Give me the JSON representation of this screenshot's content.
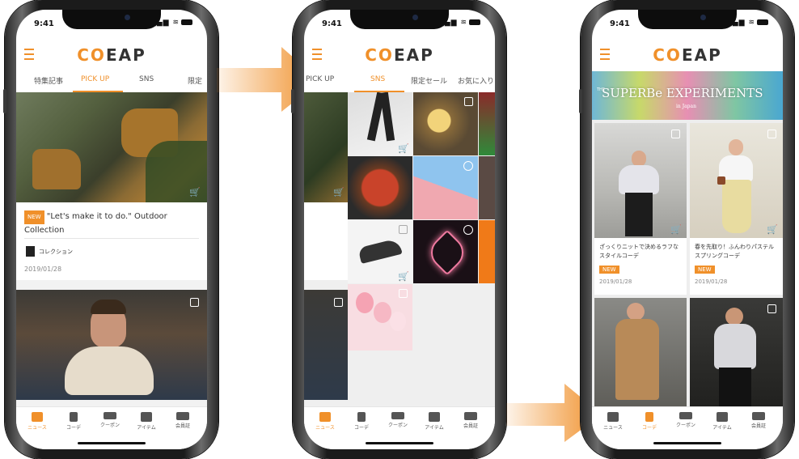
{
  "status_time": "9:41",
  "logo": {
    "mark": "CO",
    "word": "EAP"
  },
  "phone1": {
    "tabs": [
      "特集記事",
      "PICK UP",
      "SNS",
      "限定"
    ],
    "active_tab": 1,
    "card": {
      "new_label": "NEW",
      "title": "\"Let's make it to do.\" Outdoor Collection",
      "category": "コレクション",
      "date": "2019/01/28"
    }
  },
  "phone2": {
    "tabs": [
      "PICK UP",
      "SNS",
      "限定セール",
      "お気に入り"
    ],
    "active_tab": 1
  },
  "phone3": {
    "banner_text": "SUPERBe EXPERIMENTS",
    "banner_sub": "in Japan",
    "banner_small": "THE",
    "cards": [
      {
        "caption": "ざっくりニットで決めるラフなスタイルコーデ",
        "new_label": "NEW",
        "date": "2019/01/28"
      },
      {
        "caption": "春を先取り！ふんわりパステルスプリングコーデ",
        "new_label": "NEW",
        "date": "2019/01/28"
      }
    ]
  },
  "tabbar": [
    {
      "label": "ニュース",
      "icon": "news-icon"
    },
    {
      "label": "コーデ",
      "icon": "coordinate-icon"
    },
    {
      "label": "クーポン",
      "icon": "coupon-icon"
    },
    {
      "label": "アイテム",
      "icon": "bag-icon"
    },
    {
      "label": "会員証",
      "icon": "member-card-icon"
    }
  ],
  "colors": {
    "accent": "#f0902a",
    "text": "#222222"
  }
}
